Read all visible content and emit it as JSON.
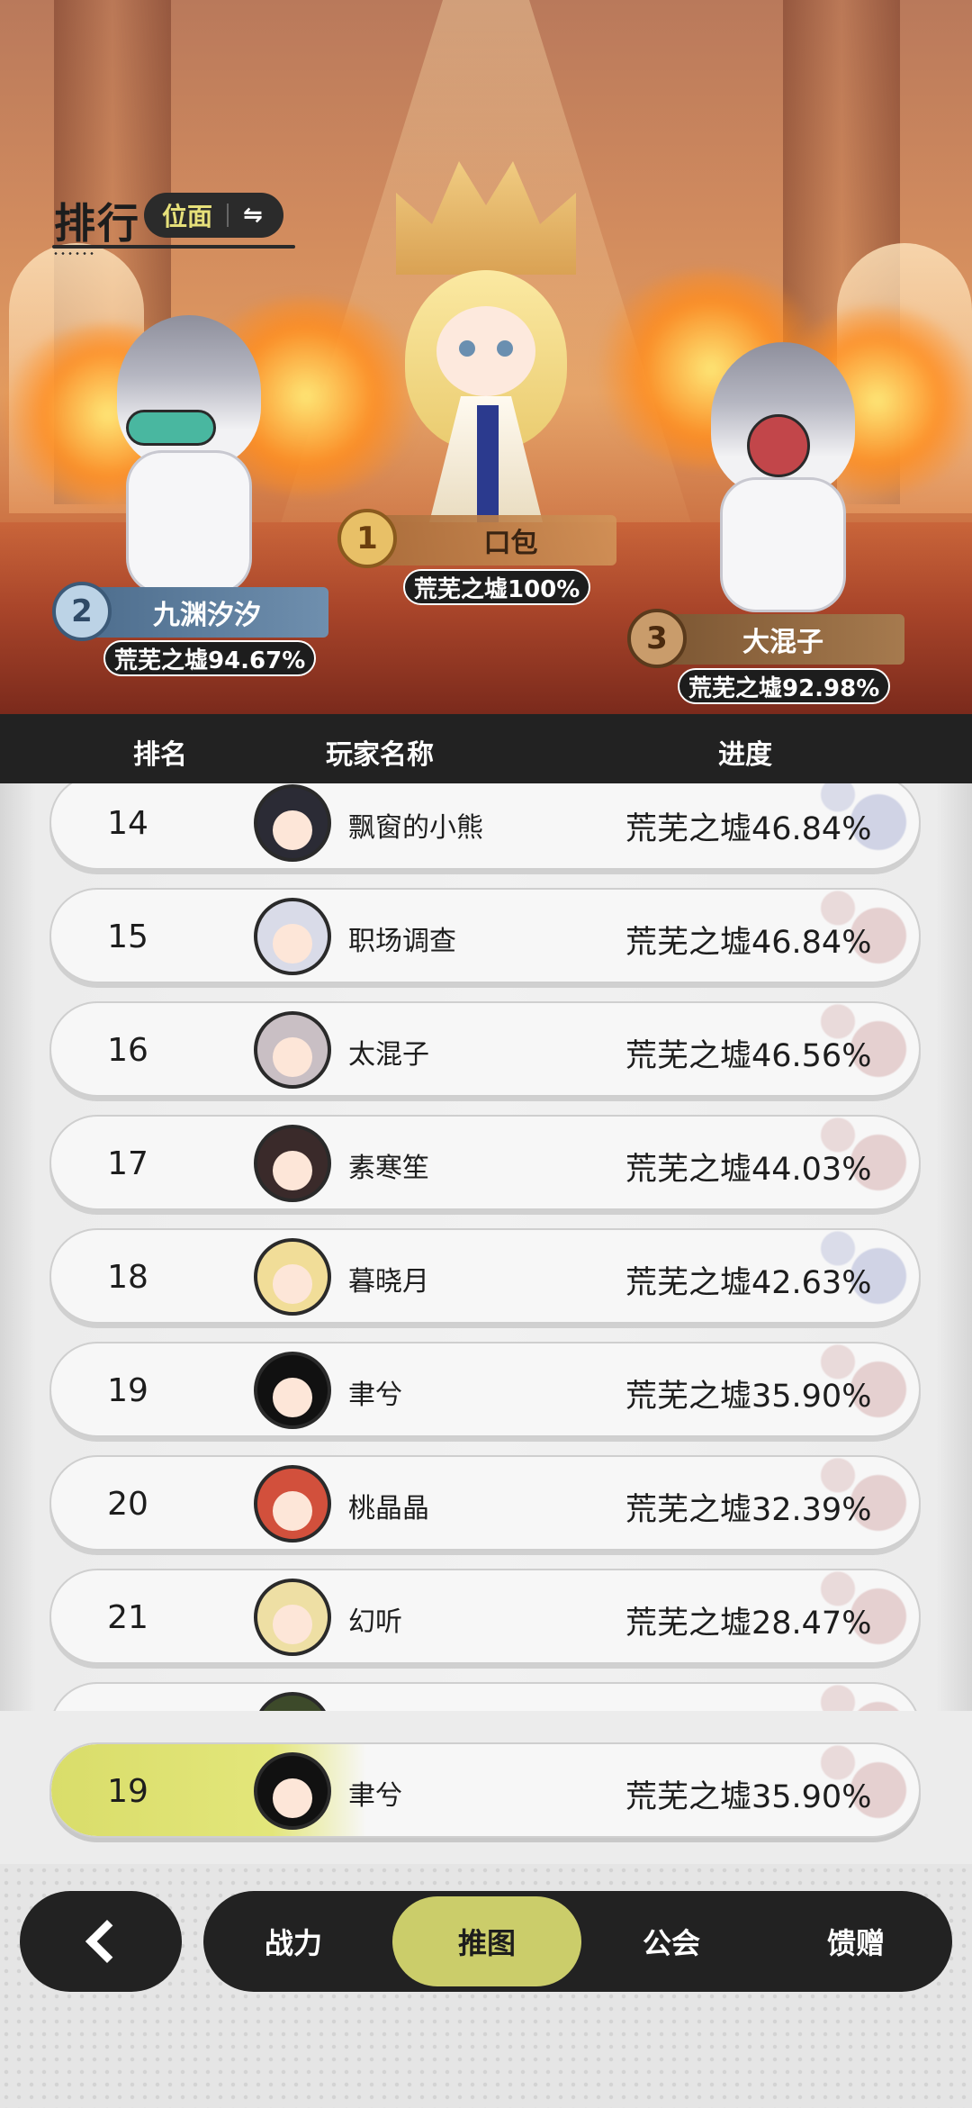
{
  "header": {
    "title": "排行",
    "toggle_label": "位面",
    "toggle_icon": "swap-icon"
  },
  "podium": [
    {
      "rank": "1",
      "name": "口包",
      "progress": "荒芜之墟100%"
    },
    {
      "rank": "2",
      "name": "九渊汐汐",
      "progress": "荒芜之墟94.67%"
    },
    {
      "rank": "3",
      "name": "大混子",
      "progress": "荒芜之墟92.98%"
    }
  ],
  "columns": {
    "rank": "排名",
    "player": "玩家名称",
    "progress": "进度"
  },
  "rows": [
    {
      "rank": "14",
      "name": "飘窗的小熊",
      "progress": "荒芜之墟46.84%",
      "avatar_color": "#2b2b35"
    },
    {
      "rank": "15",
      "name": "职场调查",
      "progress": "荒芜之墟46.84%",
      "avatar_color": "#d9dbe8"
    },
    {
      "rank": "16",
      "name": "太混子",
      "progress": "荒芜之墟46.56%",
      "avatar_color": "#c9bfc4"
    },
    {
      "rank": "17",
      "name": "素寒笙",
      "progress": "荒芜之墟44.03%",
      "avatar_color": "#3a2a2a"
    },
    {
      "rank": "18",
      "name": "暮晓月",
      "progress": "荒芜之墟42.63%",
      "avatar_color": "#f1dd98"
    },
    {
      "rank": "19",
      "name": "聿兮",
      "progress": "荒芜之墟35.90%",
      "avatar_color": "#111111"
    },
    {
      "rank": "20",
      "name": "桃晶晶",
      "progress": "荒芜之墟32.39%",
      "avatar_color": "#d2503c"
    },
    {
      "rank": "21",
      "name": "幻听",
      "progress": "荒芜之墟28.47%",
      "avatar_color": "#eedfa4"
    }
  ],
  "my_row": {
    "rank": "19",
    "name": "聿兮",
    "progress": "荒芜之墟35.90%",
    "avatar_color": "#111111"
  },
  "nav": {
    "back_icon": "chevron-left-icon",
    "tabs": [
      "战力",
      "推图",
      "公会",
      "馈赠"
    ],
    "active_tab": "推图"
  },
  "colors": {
    "accent": "#cbcd6a",
    "highlight": "#e3e67a",
    "dark": "#222222"
  }
}
